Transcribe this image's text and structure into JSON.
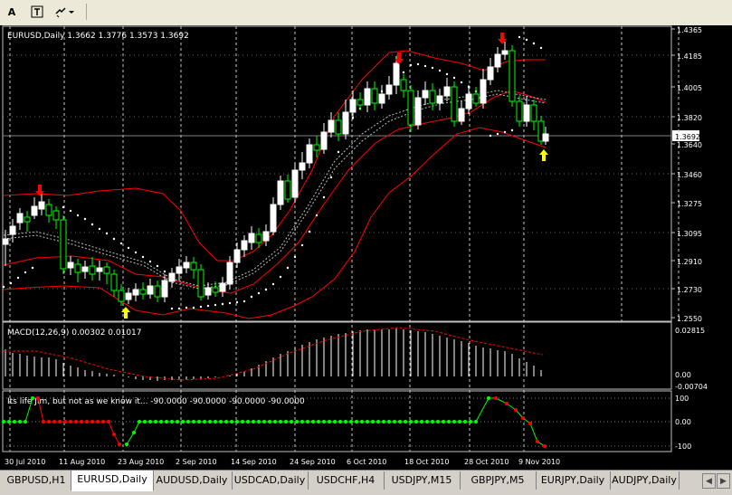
{
  "toolbar": {
    "text_label": "A"
  },
  "chart": {
    "title": "EURUSD,Daily  1.3662 1.3776 1.3573 1.3692",
    "current_price": "1.3692",
    "price_ticks": [
      "1.4365",
      "1.4185",
      "1.4005",
      "1.3820",
      "1.3640",
      "1.3460",
      "1.3275",
      "1.3095",
      "1.2910",
      "1.2730",
      "1.2550"
    ],
    "date_ticks": [
      "30 Jul 2010",
      "11 Aug 2010",
      "23 Aug 2010",
      "2 Sep 2010",
      "14 Sep 2010",
      "24 Sep 2010",
      "6 Oct 2010",
      "18 Oct 2010",
      "28 Oct 2010",
      "9 Nov 2010"
    ],
    "macd": {
      "label": "MACD(12,26,9) 0.00302 0.01017",
      "ticks": [
        "0.02815",
        "0.00",
        "-0.00704"
      ]
    },
    "indicator": {
      "label": "Its life Jim, but not as we know it... -90.0000 -90.0000 -90.0000 -90.0000",
      "ticks": [
        "100",
        "0.00",
        "-100"
      ]
    },
    "colors": {
      "bull": "#ffffff",
      "bear": "#00ff00",
      "bands": "#ff0000",
      "sar": "#ffffff",
      "macd": "#ffffff",
      "signal": "#ff0000",
      "arrow_up": "#ffff00",
      "arrow_down": "#ff0000",
      "ind_green": "#00ff00",
      "ind_red": "#ff0000"
    }
  },
  "tabs": [
    "GBPUSD,H1",
    "EURUSD,Daily",
    "AUDUSD,Daily",
    "USDCAD,Daily",
    "USDCHF,H4",
    "USDJPY,M15",
    "GBPJPY,M5",
    "EURJPY,Daily",
    "AUDJPY,Daily"
  ],
  "active_tab": "EURUSD,Daily"
}
